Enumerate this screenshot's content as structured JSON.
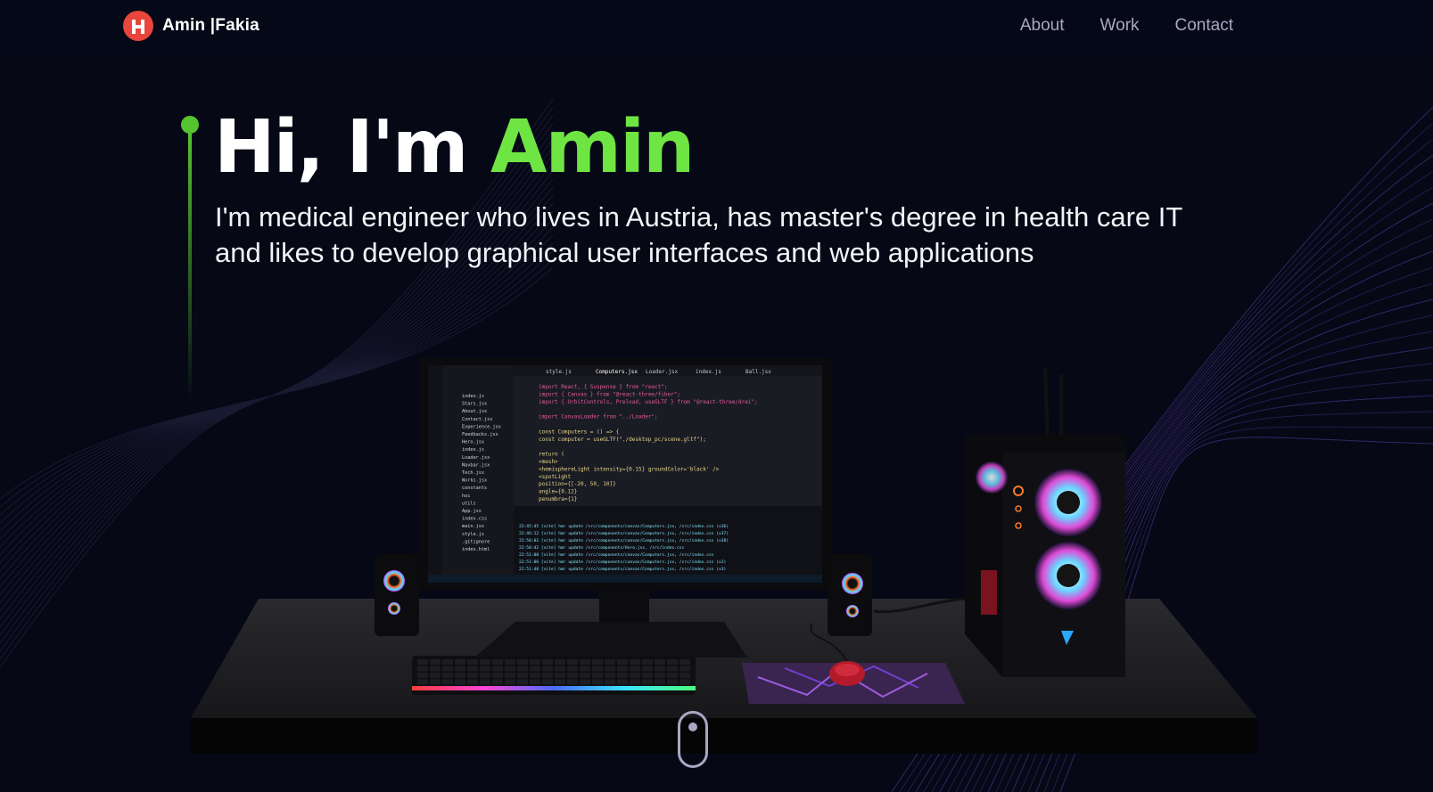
{
  "brand": {
    "name": "Amin |Fakia",
    "logo_icon": "logo-mark-icon"
  },
  "nav": {
    "links": [
      {
        "label": "About"
      },
      {
        "label": "Work"
      },
      {
        "label": "Contact"
      }
    ]
  },
  "hero": {
    "title_prefix": "Hi, I'm ",
    "title_name": "Amin",
    "subtitle": "I'm medical engineer who lives in Austria, has master's degree in health care IT and likes to develop graphical user interfaces and web applications"
  },
  "colors": {
    "background": "#060816",
    "accent": "#6fe544",
    "nav_text": "#aaa6c3",
    "logo": "#e8453c",
    "waves": "#7b4bd8"
  },
  "scene": {
    "editor": {
      "tabs": [
        "style.js",
        "Computers.jsx",
        "Loader.jsx",
        "index.js",
        "Ball.jsx"
      ],
      "files": [
        "index.js",
        "Stars.jsx",
        "About.jsx",
        "Contact.jsx",
        "Experience.jsx",
        "Feedbacks.jsx",
        "Hero.jsx",
        "index.js",
        "Loader.jsx",
        "Navbar.jsx",
        "Tech.jsx",
        "Works.jsx",
        "constants",
        "hoc",
        "utils",
        "App.jsx",
        "index.css",
        "main.jsx",
        "style.js",
        ".gitignore",
        "index.html"
      ],
      "code": [
        "import React, { Suspense } from \"react\";",
        "import { Canvas } from \"@react-three/fiber\";",
        "import { OrbitControls, Preload, useGLTF } from \"@react-three/drei\";",
        "",
        "import CanvasLoader from \"../Loader\";",
        "",
        "const Computers = () => {",
        "  const computer = useGLTF(\"./desktop_pc/scene.gltf\");",
        "",
        "  return (",
        "    <mesh>",
        "      <hemisphereLight intensity={0.15} groundColor='black' />",
        "      <spotLight",
        "        position={[-20, 50, 10]}",
        "        angle={0.12}",
        "        penumbra={1}"
      ],
      "terminal": [
        "22:45:45 [vite] hmr update /src/components/canvas/Computers.jsx, /src/index.css (x36)",
        "22:46:12 [vite] hmr update /src/components/canvas/Computers.jsx, /src/index.css (x37)",
        "22:50:02 [vite] hmr update /src/components/canvas/Computers.jsx, /src/index.css (x38)",
        "22:50:42 [vite] hmr update /src/components/Hero.jsx, /src/index.css",
        "22:51:00 [vite] hmr update /src/components/canvas/Computers.jsx, /src/index.css",
        "22:51:06 [vite] hmr update /src/components/canvas/Computers.jsx, /src/index.css (x2)",
        "22:51:40 [vite] hmr update /src/components/canvas/Computers.jsx, /src/index.css (x3)"
      ]
    }
  }
}
